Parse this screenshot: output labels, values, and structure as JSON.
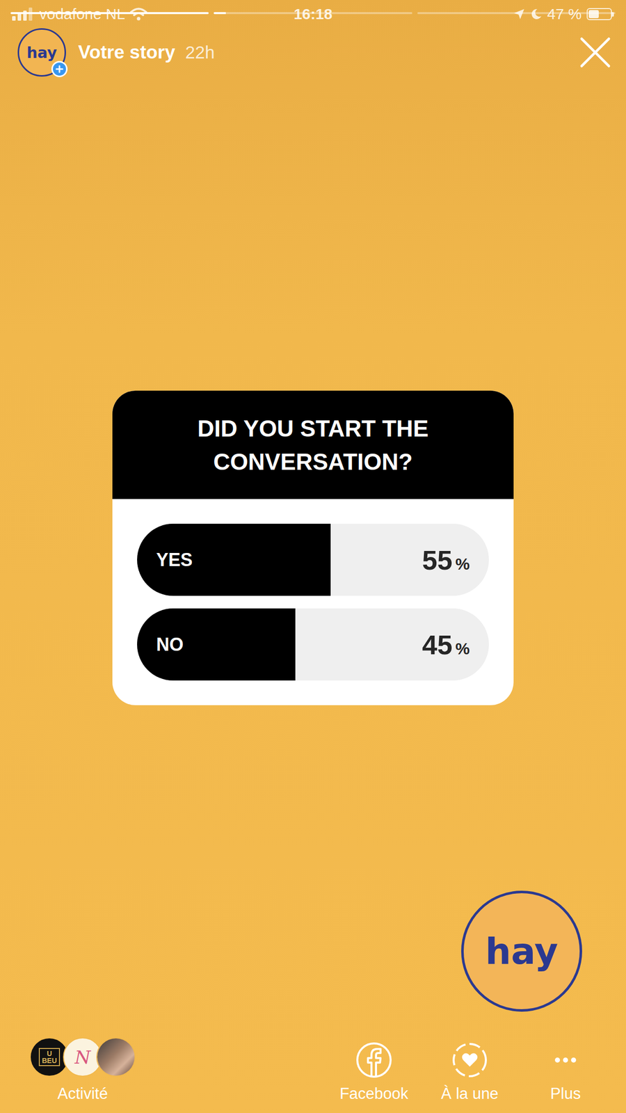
{
  "status_bar": {
    "carrier": "vodafone NL",
    "time": "16:18",
    "battery": "47 %",
    "battery_level": 0.47
  },
  "story_progress": [
    {
      "level": 1
    },
    {
      "level": 0.06
    },
    {
      "level": 0
    }
  ],
  "header": {
    "logo": "hay",
    "title": "Votre story",
    "age": "22h"
  },
  "poll": {
    "question": "DID YOU START THE CONVERSATION?",
    "options": [
      {
        "label": "YES",
        "value": "55",
        "unit": "%",
        "level": 0.55
      },
      {
        "label": "NO",
        "value": "45",
        "unit": "%",
        "level": 0.45
      }
    ]
  },
  "sticker": {
    "logo": "hay"
  },
  "bottom_bar": {
    "activity": {
      "label": "Activité",
      "viewers": [
        {
          "kind": "logo",
          "lines": [
            "U",
            "BEU"
          ]
        },
        {
          "kind": "script",
          "lines": [
            "N"
          ]
        },
        {
          "kind": "photo",
          "lines": []
        }
      ]
    },
    "actions": [
      {
        "kind": "facebook",
        "label": "Facebook"
      },
      {
        "kind": "highlight",
        "label": "À la une"
      },
      {
        "kind": "more",
        "label": "Plus"
      }
    ]
  }
}
